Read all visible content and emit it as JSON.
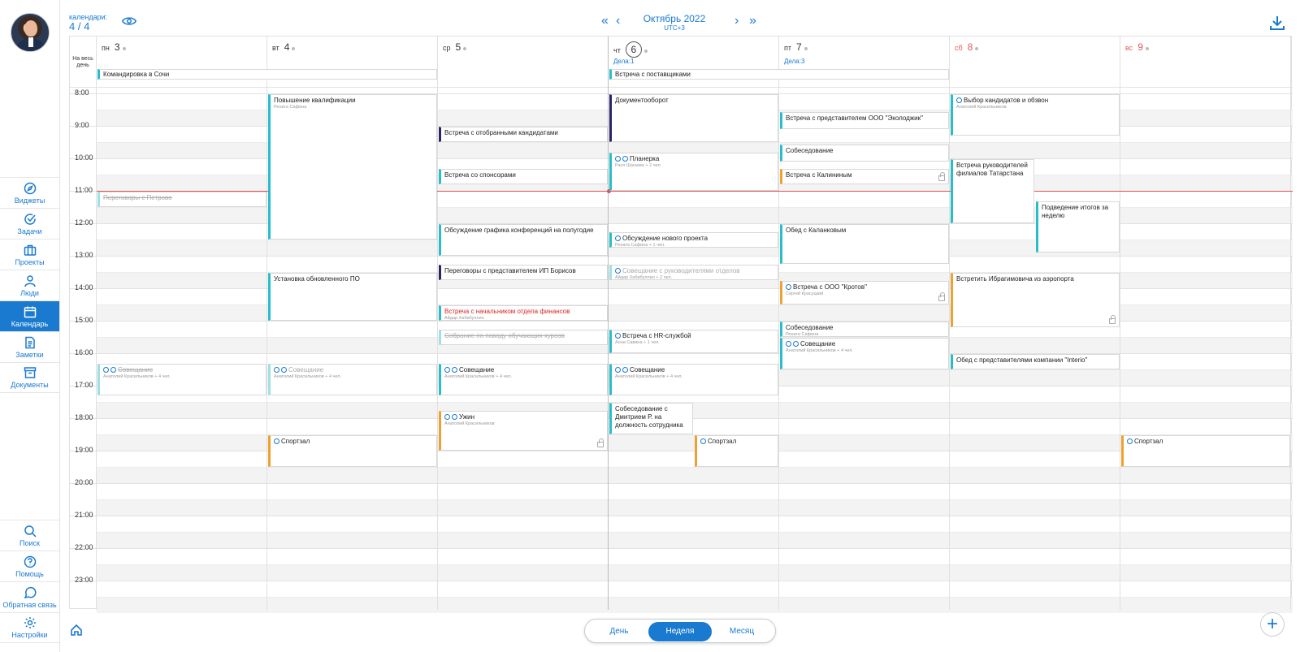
{
  "header": {
    "calendars_label": "календари:",
    "calendars_count": "4 / 4",
    "month_title": "Октябрь 2022",
    "timezone": "UTC+3",
    "prev_year": "«",
    "prev": "‹",
    "next": "›",
    "next_year": "»"
  },
  "sidebar": {
    "top": [
      {
        "label": "Виджеты",
        "icon": "compass-icon"
      },
      {
        "label": "Задачи",
        "icon": "check-circle-icon"
      },
      {
        "label": "Проекты",
        "icon": "briefcase-icon"
      },
      {
        "label": "Люди",
        "icon": "user-icon"
      },
      {
        "label": "Календарь",
        "icon": "calendar-icon",
        "active": true
      },
      {
        "label": "Заметки",
        "icon": "note-icon"
      },
      {
        "label": "Документы",
        "icon": "archive-icon"
      }
    ],
    "bottom": [
      {
        "label": "Поиск",
        "icon": "search-icon"
      },
      {
        "label": "Помощь",
        "icon": "help-icon"
      },
      {
        "label": "Обратная связь",
        "icon": "chat-icon"
      },
      {
        "label": "Настройки",
        "icon": "gear-icon"
      }
    ]
  },
  "week": {
    "allday_label": "На весь день",
    "days": [
      {
        "abbr": "пн",
        "num": "3"
      },
      {
        "abbr": "вт",
        "num": "4"
      },
      {
        "abbr": "ср",
        "num": "5"
      },
      {
        "abbr": "чт",
        "num": "6",
        "today": true,
        "tasks": "Дела:1"
      },
      {
        "abbr": "пт",
        "num": "7",
        "tasks": "Дела:3"
      },
      {
        "abbr": "сб",
        "num": "8",
        "weekend": true
      },
      {
        "abbr": "вс",
        "num": "9",
        "weekend": true
      }
    ],
    "hours": [
      "8:00",
      "9:00",
      "10:00",
      "11:00",
      "12:00",
      "13:00",
      "14:00",
      "15:00",
      "16:00",
      "17:00",
      "18:00",
      "19:00",
      "20:00",
      "21:00",
      "22:00",
      "23:00"
    ],
    "allday_events": [
      {
        "title": "Командировка в Сочи",
        "from": 0,
        "to": 2
      },
      {
        "title": "Встреча с поставщиками",
        "from": 3,
        "to": 5
      }
    ],
    "events": [
      {
        "day": 1,
        "start": 8.0,
        "end": 12.5,
        "title": "Повышение квалификации",
        "sub": "Рената Сафина",
        "color": "teal"
      },
      {
        "day": 1,
        "start": 13.5,
        "end": 15.0,
        "title": "Установка обновленного ПО",
        "color": "teal"
      },
      {
        "day": 1,
        "start": 16.3,
        "end": 17.3,
        "title": "Совещание",
        "sub": "Анатолий Красильников + 4 чел.",
        "color": "faded",
        "icons": 2
      },
      {
        "day": 1,
        "start": 18.5,
        "end": 19.5,
        "title": "Спортзал",
        "color": "orange",
        "icons": 1
      },
      {
        "day": 0,
        "start": 11.0,
        "end": 11.5,
        "title": "Переговоры с Петрово",
        "color": "faded",
        "strike": true
      },
      {
        "day": 0,
        "start": 16.3,
        "end": 17.3,
        "title": "Совещание",
        "sub": "Анатолий Красильников + 4 чел.",
        "color": "faded",
        "strike": true,
        "icons": 2
      },
      {
        "day": 2,
        "start": 9.0,
        "end": 9.5,
        "title": "Встреча с отобранными кандидатами",
        "color": "navy"
      },
      {
        "day": 2,
        "start": 10.3,
        "end": 10.8,
        "title": "Встреча со спонсорами",
        "color": "teal"
      },
      {
        "day": 2,
        "start": 12.0,
        "end": 13.0,
        "title": "Обсуждение графика конференций на полугодие",
        "color": "teal"
      },
      {
        "day": 2,
        "start": 13.25,
        "end": 13.75,
        "title": "Переговоры с представителем ИП Борисов",
        "color": "navy"
      },
      {
        "day": 2,
        "start": 14.5,
        "end": 15.0,
        "title": "Встреча с начальником отдела финансов",
        "sub": "Айдар Хабибуллин",
        "color": "teal",
        "red": true
      },
      {
        "day": 2,
        "start": 15.25,
        "end": 15.75,
        "title": "Собрание по поводу обучающих курсов",
        "color": "faded",
        "strike": true
      },
      {
        "day": 2,
        "start": 16.3,
        "end": 17.3,
        "title": "Совещание",
        "sub": "Анатолий Красильников + 4 чел.",
        "color": "teal",
        "icons": 2
      },
      {
        "day": 2,
        "start": 17.75,
        "end": 19.0,
        "title": "Ужин",
        "sub": "Анатолий Красильников",
        "color": "orange",
        "icons": 2,
        "lock": true
      },
      {
        "day": 3,
        "start": 8.0,
        "end": 9.5,
        "title": "Документооборот",
        "color": "navy"
      },
      {
        "day": 3,
        "start": 9.8,
        "end": 11.0,
        "title": "Планерка",
        "sub": "Рася Шагаева + 2 чел.",
        "color": "teal",
        "icons": 2
      },
      {
        "day": 3,
        "start": 12.25,
        "end": 12.75,
        "title": "Обсуждение нового проекта",
        "sub": "Рената Сафина + 1 чел.",
        "color": "teal",
        "icons": 1
      },
      {
        "day": 3,
        "start": 13.25,
        "end": 13.75,
        "title": "Совещание с руководителями отделов",
        "sub": "Айдар Хабибуллин + 2 чел.",
        "color": "faded",
        "icons": 1
      },
      {
        "day": 3,
        "start": 15.25,
        "end": 16.0,
        "title": "Встреча с HR-службой",
        "sub": "Анна Савина + 1 чел.",
        "color": "teal",
        "icons": 1
      },
      {
        "day": 3,
        "start": 16.3,
        "end": 17.3,
        "title": "Совещание",
        "sub": "Анатолий Красильников + 4 чел.",
        "color": "teal",
        "icons": 2
      },
      {
        "day": 3,
        "start": 17.5,
        "end": 18.5,
        "title": "Собеседование с Дмитрием Р. на должность сотрудника ...",
        "color": "teal",
        "half": "left"
      },
      {
        "day": 3,
        "start": 18.5,
        "end": 19.5,
        "title": "Спортзал",
        "color": "orange",
        "icons": 1,
        "half": "right"
      },
      {
        "day": 4,
        "start": 8.55,
        "end": 9.1,
        "title": "Встреча с представителем ООО \"Эколоджик\"",
        "color": "teal"
      },
      {
        "day": 4,
        "start": 9.55,
        "end": 10.1,
        "title": "Собеседование",
        "color": "teal"
      },
      {
        "day": 4,
        "start": 10.3,
        "end": 10.8,
        "title": "Встреча с Калининым",
        "color": "orange",
        "lock": true
      },
      {
        "day": 4,
        "start": 12.0,
        "end": 13.25,
        "title": "Обед с Каланковым",
        "color": "teal"
      },
      {
        "day": 4,
        "start": 13.75,
        "end": 14.5,
        "title": "Встреча с ООО \"Кротов\"",
        "sub": "Сергей Красуцкий",
        "color": "orange",
        "icons": 1,
        "lock": true
      },
      {
        "day": 4,
        "start": 15.0,
        "end": 15.5,
        "title": "Собеседование",
        "sub": "Рената Сафина",
        "color": "teal"
      },
      {
        "day": 4,
        "start": 15.5,
        "end": 16.5,
        "title": "Совещание",
        "sub": "Анатолий Красильников + 4 чел.",
        "color": "teal",
        "icons": 2
      },
      {
        "day": 5,
        "start": 8.0,
        "end": 9.3,
        "title": "Выбор кандидатов и обзвон",
        "sub": "Анатолий Красильников",
        "color": "teal",
        "icons": 1
      },
      {
        "day": 5,
        "start": 10.0,
        "end": 12.0,
        "title": "Встреча руководителей филиалов Татарстана",
        "color": "teal",
        "half": "left"
      },
      {
        "day": 5,
        "start": 11.3,
        "end": 12.9,
        "title": "Подведение итогов за неделю",
        "color": "teal",
        "half": "right"
      },
      {
        "day": 5,
        "start": 13.5,
        "end": 15.2,
        "title": "Встретить Ибрагимовича из аэропорта",
        "color": "orange",
        "lock": true
      },
      {
        "day": 5,
        "start": 16.0,
        "end": 16.5,
        "title": "Обед с представителями компании \"Interio\"",
        "color": "teal"
      },
      {
        "day": 6,
        "start": 18.5,
        "end": 19.5,
        "title": "Спортзал",
        "color": "orange",
        "icons": 1
      }
    ],
    "now_hour": 11.0
  },
  "views": {
    "day": "День",
    "week": "Неделя",
    "month": "Месяц",
    "active": "week"
  },
  "colors": {
    "accent": "#1a7ad0",
    "teal": "#26bfc9",
    "orange": "#f0a030",
    "navy": "#2b2463",
    "now": "#e05050"
  }
}
